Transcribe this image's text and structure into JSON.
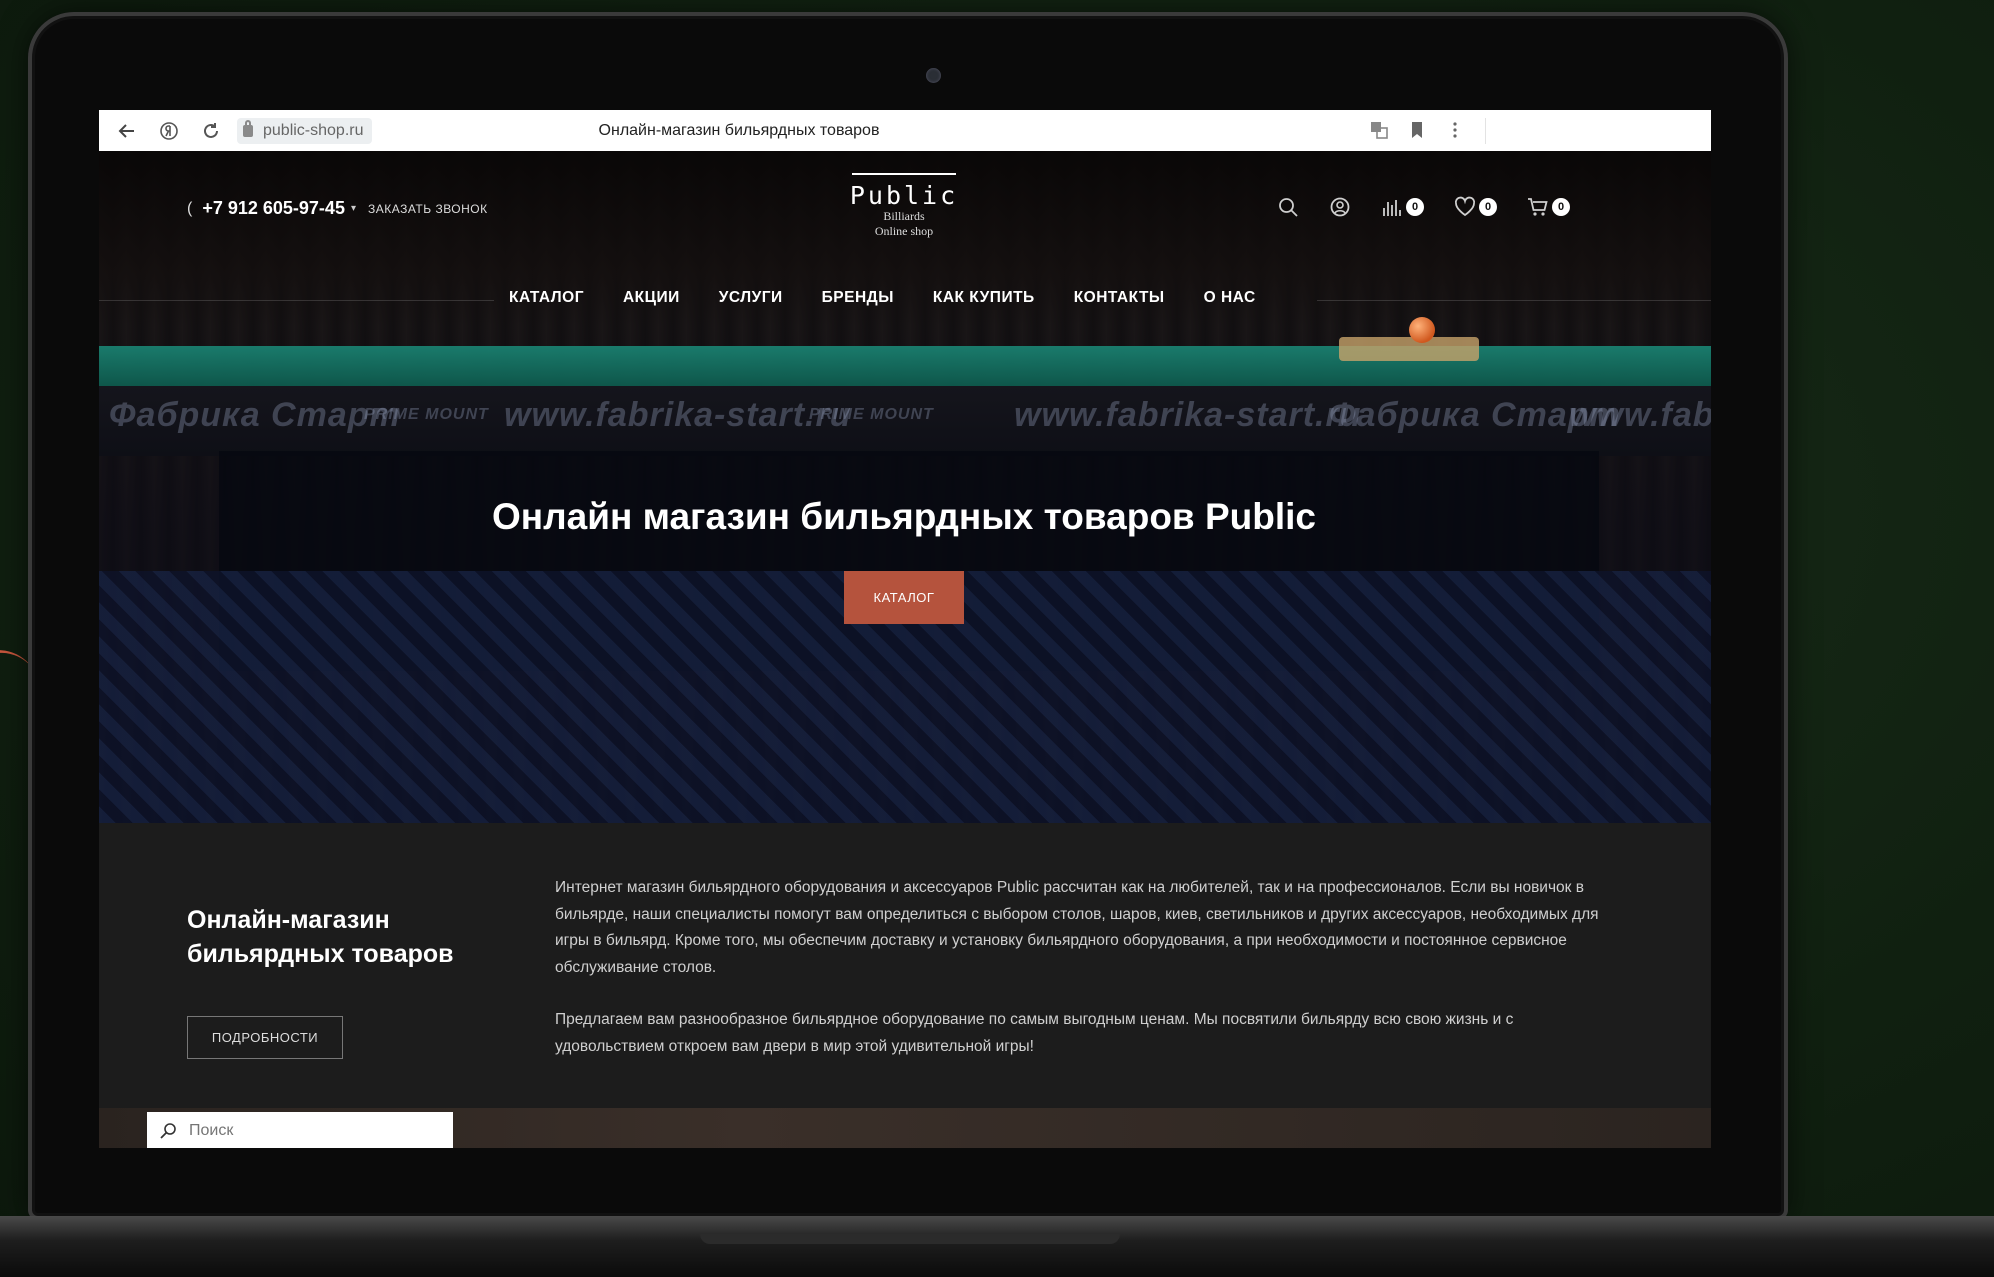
{
  "browser": {
    "url": "public-shop.ru",
    "tab_title": "Онлайн-магазин бильярдных товаров"
  },
  "header": {
    "phone": "+7 912 605-97-45",
    "callback_label": "ЗАКАЗАТЬ ЗВОНОК",
    "logo": {
      "main": "Public",
      "line1": "Billiards",
      "line2": "Online shop"
    },
    "compare_count": "0",
    "favorites_count": "0",
    "cart_count": "0"
  },
  "nav": {
    "items": [
      "КАТАЛОГ",
      "АКЦИИ",
      "УСЛУГИ",
      "БРЕНДЫ",
      "КАК КУПИТЬ",
      "КОНТАКТЫ",
      "О НАС"
    ]
  },
  "hero": {
    "title": "Онлайн магазин бильярдных товаров Public",
    "button_label": "КАТАЛОГ",
    "banner_texts": [
      "Фабрика Старт",
      "PRIME MOUNT",
      "www.fabrika-start.ru",
      "PRIME MOUNT",
      "www.fabrika-start.ru",
      "Фабрика Старт",
      "www.fabrika"
    ]
  },
  "about": {
    "title": "Онлайн-магазин бильярдных товаров",
    "button_label": "ПОДРОБНОСТИ",
    "paragraph1": "Интернет магазин бильярдного оборудования и аксессуаров Public рассчитан как на любителей, так и на профессионалов. Если вы новичок в бильярде, наши специалисты помогут вам определиться с выбором столов, шаров, киев, светильников и других аксессуаров, необходимых для игры в бильярд. Кроме того, мы обеспечим доставку и установку бильярдного оборудования, а при необходимости и постоянное сервисное обслуживание столов.",
    "paragraph2": "Предлагаем вам разнообразное бильярдное оборудование по самым выгодным ценам. Мы посвятили бильярду всю свою жизнь и с удовольствием откроем вам двери в мир этой удивительной игры!"
  },
  "search": {
    "placeholder": "Поиск"
  },
  "colors": {
    "accent": "#b5533d",
    "background": "#132313",
    "about_bg": "#1c1c1c"
  }
}
